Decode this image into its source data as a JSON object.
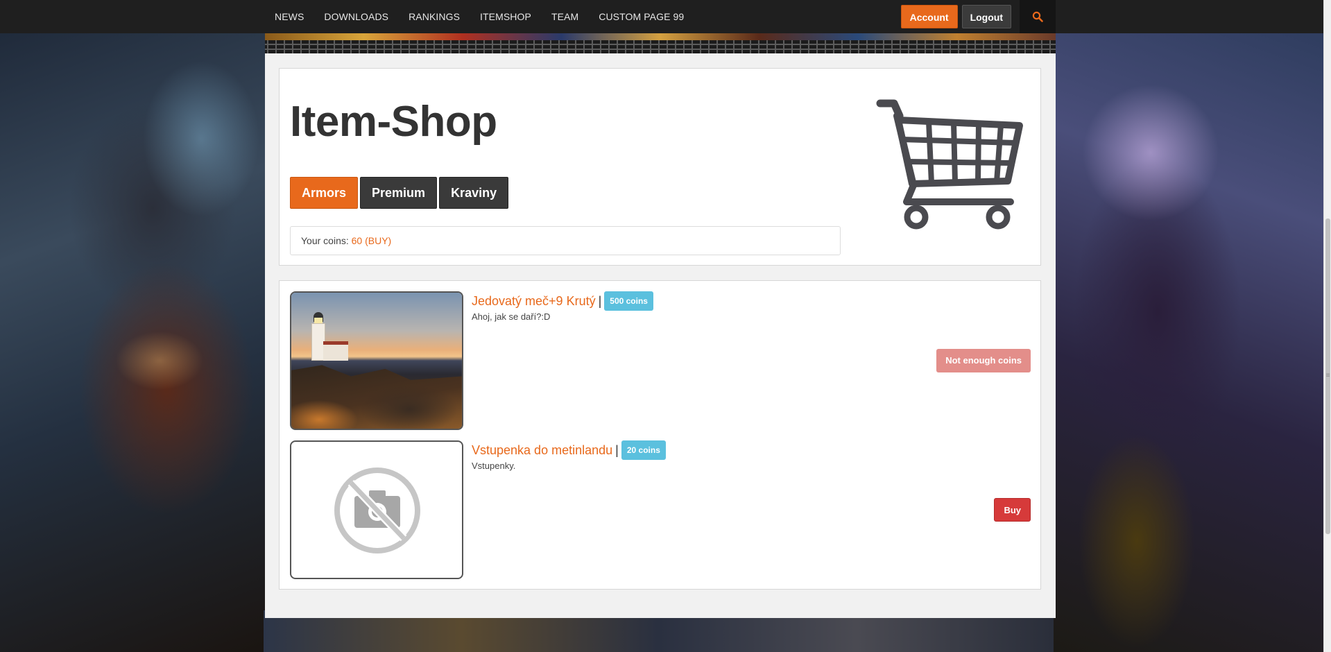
{
  "nav": {
    "links": [
      "NEWS",
      "DOWNLOADS",
      "RANKINGS",
      "ITEMSHOP",
      "TEAM",
      "CUSTOM PAGE 99"
    ],
    "account_label": "Account",
    "logout_label": "Logout",
    "search_icon": "search-icon"
  },
  "shop": {
    "title": "Item-Shop",
    "cart_icon": "shopping-cart-icon",
    "tabs": [
      "Armors",
      "Premium",
      "Kraviny"
    ],
    "active_tab": "Armors",
    "coins_label": "Your coins:",
    "coins_value": "60 (BUY)"
  },
  "items": [
    {
      "name": "Jedovatý meč+9 Krutý",
      "separator": "|",
      "price": "500 coins",
      "description": "Ahoj, jak se daří?:D",
      "action_label": "Not enough coins",
      "image": "lighthouse-photo"
    },
    {
      "name": "Vstupenka do metinlandu",
      "separator": "|",
      "price": "20 coins",
      "description": "Vstupenky.",
      "action_label": "Buy",
      "image": "no-image-icon"
    }
  ],
  "colors": {
    "accent": "#e8691c",
    "badge": "#5bc0de",
    "danger": "#d63a3a",
    "danger_disabled": "#e38e8a",
    "topbar": "#1f1f1f"
  }
}
